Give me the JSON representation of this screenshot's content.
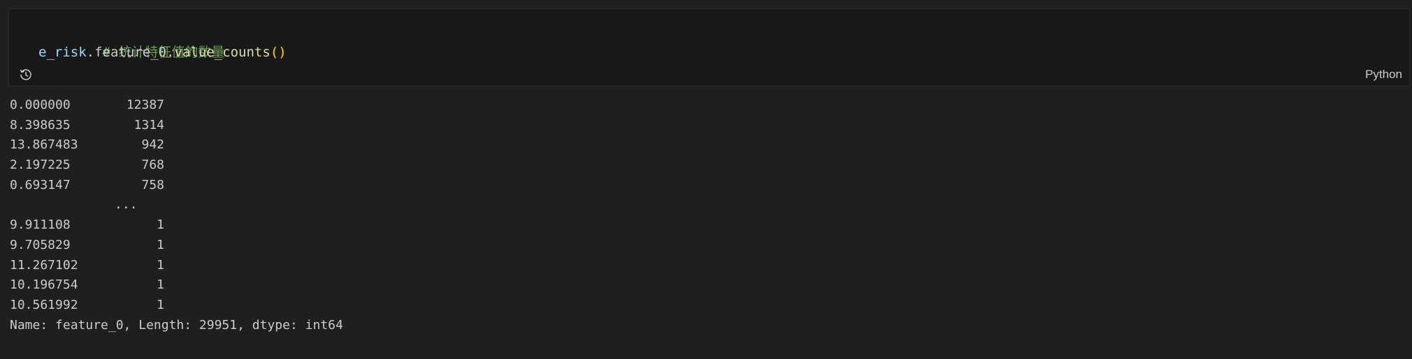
{
  "cell": {
    "code_lines": [
      {
        "comment": "# 统计特征值的数量"
      },
      {
        "var": "e_risk",
        "dot1": ".",
        "attr": "feature_0",
        "dot2": ".",
        "func": "value_counts",
        "parens": "()"
      }
    ],
    "language": "Python",
    "history_icon": "history-icon"
  },
  "output": {
    "top_rows": [
      {
        "index": "0.000000",
        "count": "12387"
      },
      {
        "index": "8.398635",
        "count": "1314"
      },
      {
        "index": "13.867483",
        "count": "942"
      },
      {
        "index": "2.197225",
        "count": "768"
      },
      {
        "index": "0.693147",
        "count": "758"
      }
    ],
    "ellipsis": "...",
    "bottom_rows": [
      {
        "index": "9.911108",
        "count": "1"
      },
      {
        "index": "9.705829",
        "count": "1"
      },
      {
        "index": "11.267102",
        "count": "1"
      },
      {
        "index": "10.196754",
        "count": "1"
      },
      {
        "index": "10.561992",
        "count": "1"
      }
    ],
    "footer": "Name: feature_0, Length: 29951, dtype: int64"
  },
  "colors": {
    "background": "#1f1f1f",
    "cell_background": "#181818",
    "comment": "#6a9955",
    "variable": "#9cdcfe",
    "function": "#dcdcaa",
    "paren": "#ffd700"
  }
}
